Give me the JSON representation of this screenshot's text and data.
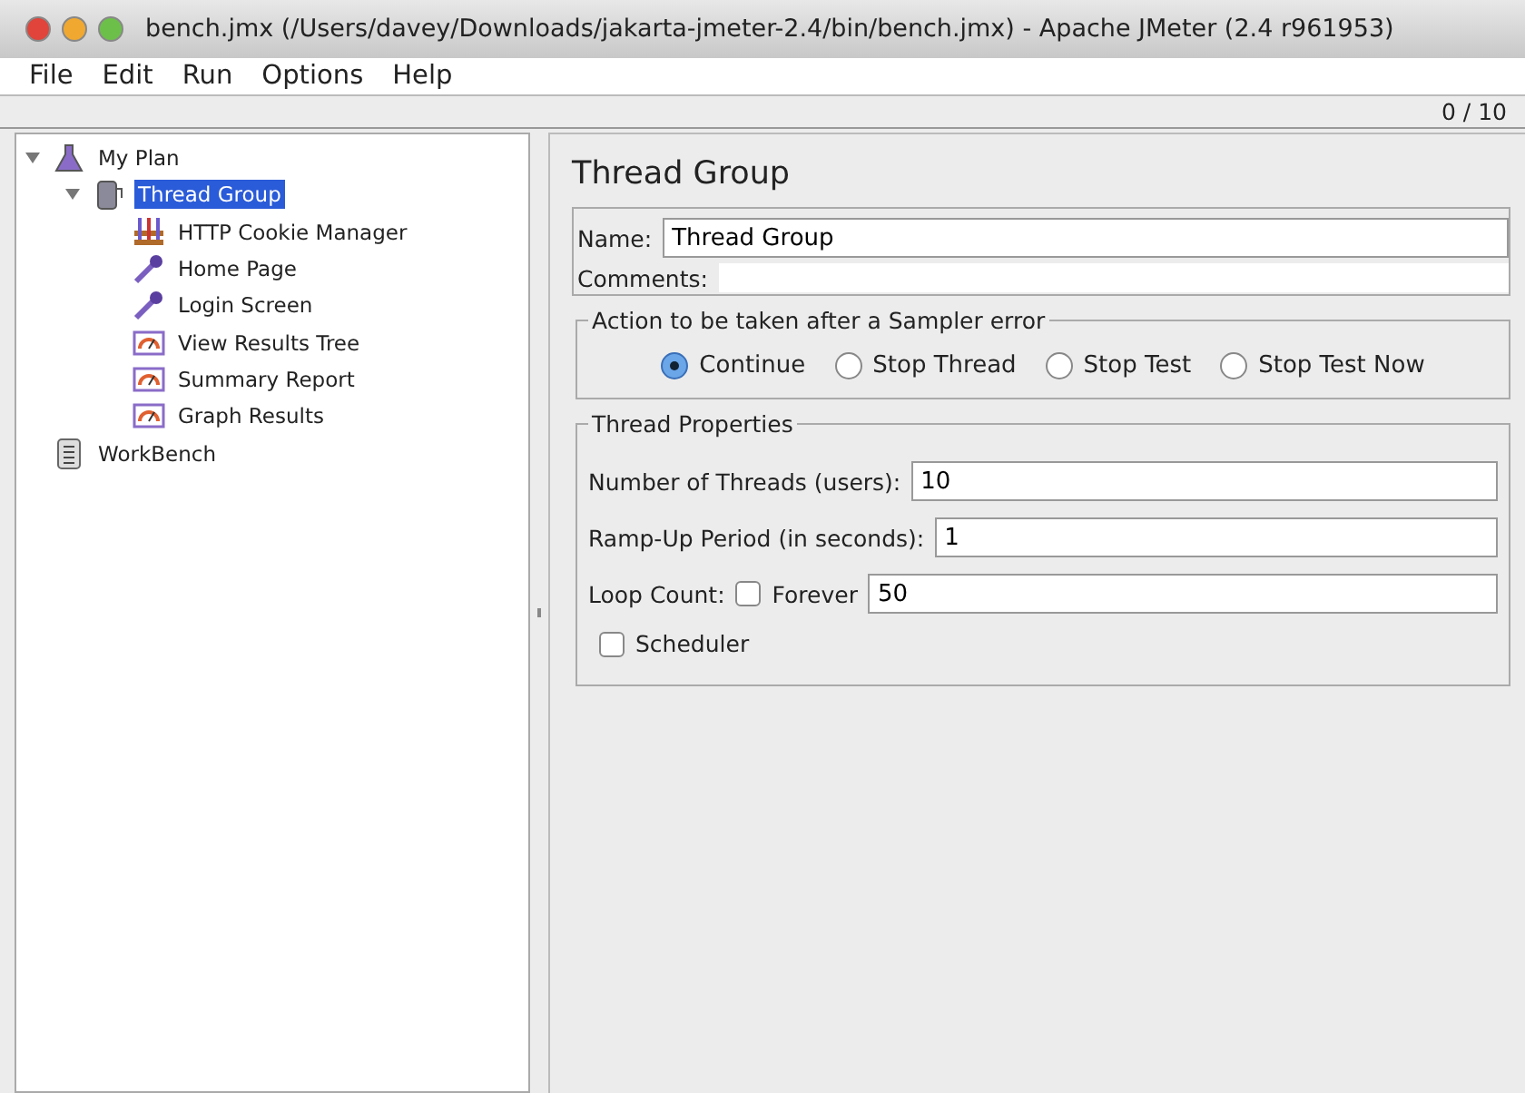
{
  "window": {
    "title": "bench.jmx (/Users/davey/Downloads/jakarta-jmeter-2.4/bin/bench.jmx) - Apache JMeter (2.4 r961953)"
  },
  "menu": [
    "File",
    "Edit",
    "Run",
    "Options",
    "Help"
  ],
  "toolbar": {
    "counter": "0 / 10"
  },
  "tree": [
    {
      "label": "My Plan",
      "kind": "plan",
      "expanded": true,
      "selected": false,
      "children": [
        {
          "label": "Thread Group",
          "kind": "thread-group",
          "expanded": true,
          "selected": true,
          "children": [
            {
              "label": "HTTP Cookie Manager",
              "kind": "config",
              "selected": false
            },
            {
              "label": "Home Page",
              "kind": "sampler",
              "selected": false
            },
            {
              "label": "Login Screen",
              "kind": "sampler",
              "selected": false
            },
            {
              "label": "View Results Tree",
              "kind": "listener",
              "selected": false
            },
            {
              "label": "Summary Report",
              "kind": "listener",
              "selected": false
            },
            {
              "label": "Graph Results",
              "kind": "listener",
              "selected": false
            }
          ]
        }
      ]
    },
    {
      "label": "WorkBench",
      "kind": "workbench",
      "selected": false
    }
  ],
  "panel": {
    "title": "Thread Group",
    "name": {
      "label": "Name:",
      "value": "Thread Group"
    },
    "comments": {
      "label": "Comments:"
    },
    "error_action": {
      "legend": "Action to be taken after a Sampler error",
      "options": [
        {
          "label": "Continue",
          "selected": true
        },
        {
          "label": "Stop Thread",
          "selected": false
        },
        {
          "label": "Stop Test",
          "selected": false
        },
        {
          "label": "Stop Test Now",
          "selected": false
        }
      ]
    },
    "thread_properties": {
      "legend": "Thread Properties",
      "threads": {
        "label": "Number of Threads (users):",
        "value": "10"
      },
      "ramp_up": {
        "label": "Ramp-Up Period (in seconds):",
        "value": "1"
      },
      "loop_count": {
        "label": "Loop Count:",
        "forever": {
          "label": "Forever",
          "checked": false
        },
        "value": "50"
      },
      "scheduler": {
        "label": "Scheduler",
        "checked": false
      }
    }
  }
}
